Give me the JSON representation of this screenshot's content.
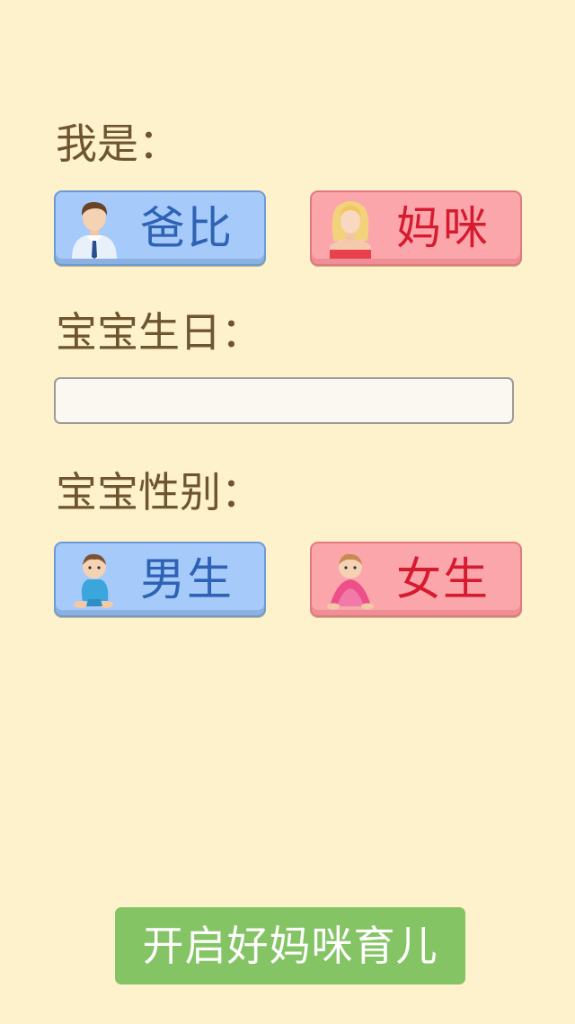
{
  "form": {
    "identity_label": "我是：",
    "identity_options": [
      {
        "label": "爸比",
        "icon": "dad-avatar-icon"
      },
      {
        "label": "妈咪",
        "icon": "mom-avatar-icon"
      }
    ],
    "birthday_label": "宝宝生日：",
    "birthday_value": "",
    "gender_label": "宝宝性别：",
    "gender_options": [
      {
        "label": "男生",
        "icon": "baby-boy-icon"
      },
      {
        "label": "女生",
        "icon": "baby-girl-icon"
      }
    ],
    "submit_label": "开启好妈咪育儿"
  },
  "colors": {
    "background": "#fdf2cb",
    "label_text": "#6e5530",
    "blue_button": "#a6caf9",
    "blue_text": "#2e62b5",
    "pink_button": "#fba6ab",
    "pink_text": "#d61b30",
    "submit_button": "#84c464"
  }
}
